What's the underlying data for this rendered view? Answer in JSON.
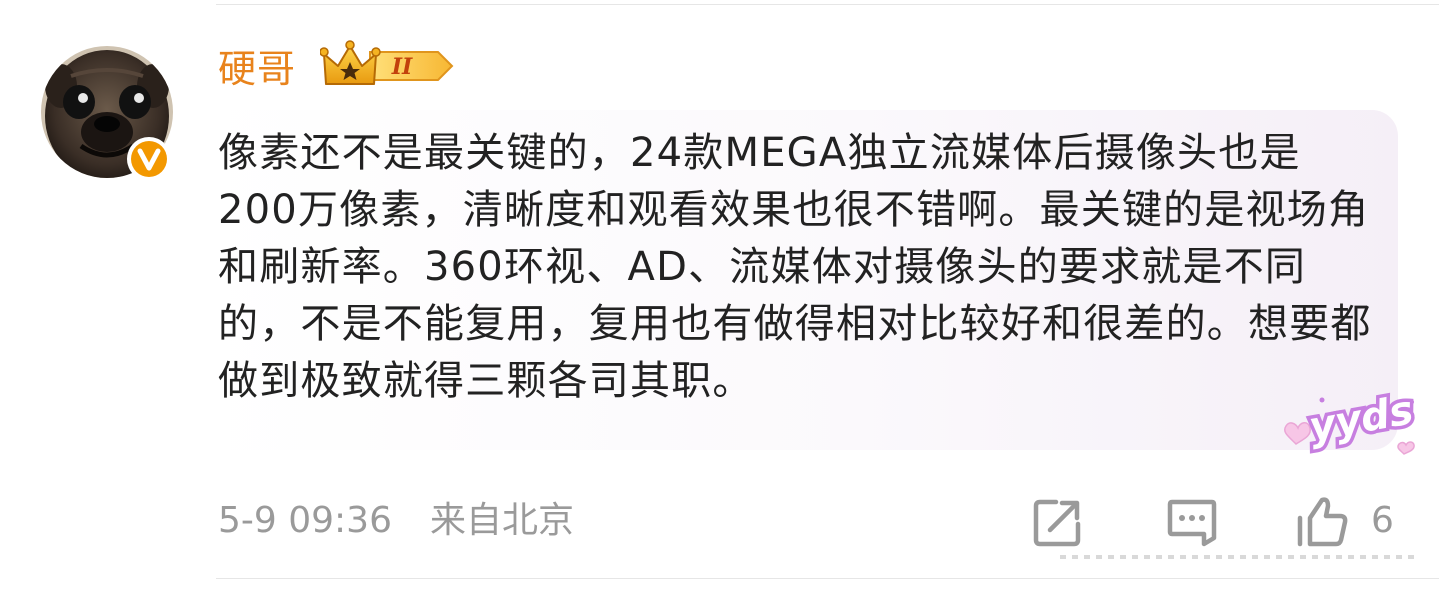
{
  "comment": {
    "author": {
      "name": "硬哥",
      "avatar_icon": "pug-avatar",
      "verified_icon": "verified-v-badge-icon",
      "member_badge_icon": "crown-level-badge-icon",
      "member_badge_text": "II"
    },
    "text": "像素还不是最关键的，24款MEGA独立流媒体后摄像头也是200万像素，清晰度和观看效果也很不错啊。最关键的是视场角和刷新率。360环视、AD、流媒体对摄像头的要求就是不同的，不是不能复用，复用也有做得相对比较好和很差的。想要都做到极致就得三颗各司其职。",
    "sticker": {
      "text": "yyds",
      "icon": "heart-sticker-icon",
      "color": "#c77fe0"
    },
    "time": "5-9 09:36",
    "location": "来自北京",
    "actions": {
      "share_icon": "share-icon",
      "reply_icon": "comment-icon",
      "like_icon": "thumbs-up-icon",
      "like_count": "6"
    }
  },
  "colors": {
    "username": "#e8831c",
    "text": "#222222",
    "meta": "#9a9a9a",
    "verified": "#f39800",
    "crown": "#f5b321"
  }
}
